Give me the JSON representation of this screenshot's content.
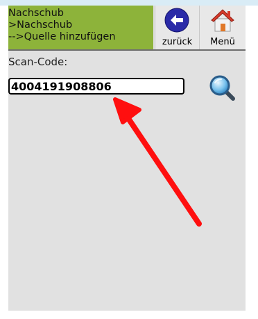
{
  "header": {
    "title_lines": [
      "Nachschub",
      ">Nachschub",
      "-->Quelle hinzufügen"
    ],
    "back_label": "zurück",
    "menu_label": "Menü"
  },
  "form": {
    "scan_label": "Scan-Code:",
    "scan_value": "4004191908806"
  },
  "icons": {
    "back": "arrow-left-circle-icon",
    "menu": "home-icon",
    "search": "magnifier-icon",
    "annotation": "red-arrow-icon"
  },
  "colors": {
    "header_green": "#8db33a",
    "back_circle": "#2a2aa8",
    "arrow_red": "#ff0f0f",
    "roof_red": "#d63a2a"
  }
}
